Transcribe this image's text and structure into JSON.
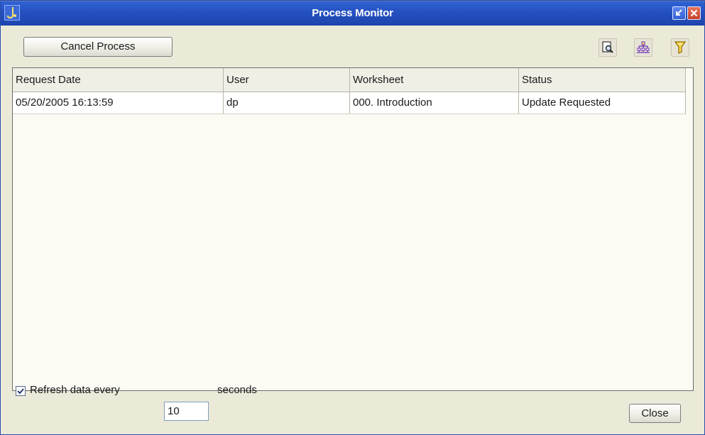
{
  "window": {
    "title": "Process Monitor"
  },
  "toolbar": {
    "cancel_label": "Cancel Process",
    "icons": [
      "find-icon",
      "hierarchy-icon",
      "filter-icon"
    ]
  },
  "table": {
    "columns": [
      "Request Date",
      "User",
      "Worksheet",
      "Status"
    ],
    "rows": [
      [
        "05/20/2005 16:13:59",
        "dp",
        "000. Introduction",
        "Update Requested"
      ]
    ]
  },
  "footer": {
    "refresh_checked": true,
    "refresh_label": "Refresh data every",
    "interval_value": "10",
    "seconds_label": "seconds",
    "close_label": "Close"
  },
  "colors": {
    "titlebar": "#2550bf",
    "window_bg": "#ebe9d8",
    "table_bg": "#fbfaf3"
  }
}
